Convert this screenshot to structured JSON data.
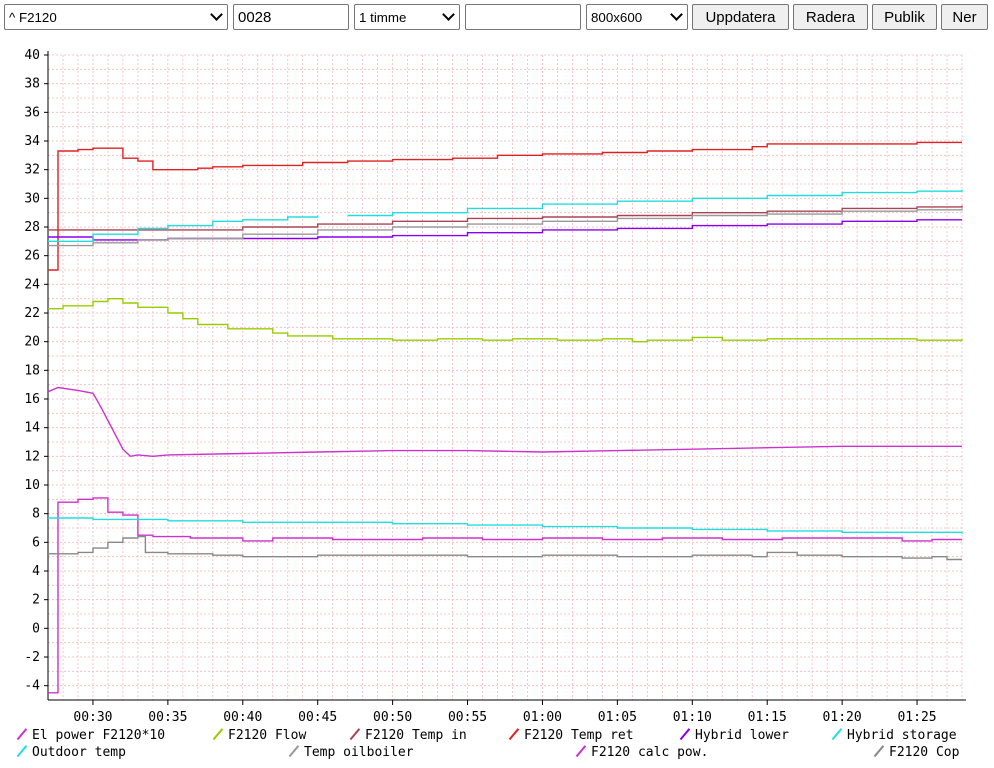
{
  "toolbar": {
    "device_select": "^ F2120",
    "id_input": "0028",
    "period_select": "1 timme",
    "free_input": "",
    "size_select": "800x600",
    "update_label": "Uppdatera",
    "delete_label": "Radera",
    "public_label": "Publik",
    "down_label": "Ner"
  },
  "chart_data": {
    "type": "line",
    "ylim": [
      -5,
      40
    ],
    "xlim": [
      "00:27",
      "01:28"
    ],
    "grid": true,
    "legend_position": "bottom",
    "y_ticks": [
      40,
      38,
      36,
      34,
      32,
      30,
      28,
      26,
      24,
      22,
      20,
      18,
      16,
      14,
      12,
      10,
      8,
      6,
      4,
      2,
      0,
      -2,
      -4
    ],
    "x_ticks": [
      "00:30",
      "00:35",
      "00:40",
      "00:45",
      "00:50",
      "00:55",
      "01:00",
      "01:05",
      "01:10",
      "01:15",
      "01:20",
      "01:25"
    ],
    "series": [
      {
        "name": "El power F2120*10",
        "color": "#cc33cc",
        "step": true,
        "points": [
          [
            "00:27",
            -4.5
          ],
          [
            "00:27:30",
            -4.5
          ],
          [
            "00:27:40",
            8.8
          ],
          [
            "00:29",
            9.0
          ],
          [
            "00:30",
            9.1
          ],
          [
            "00:31",
            8.1
          ],
          [
            "00:32",
            7.9
          ],
          [
            "00:33",
            6.5
          ],
          [
            "00:34",
            6.4
          ],
          [
            "00:36",
            6.4
          ],
          [
            "00:36:30",
            6.3
          ],
          [
            "00:40",
            6.1
          ],
          [
            "00:42",
            6.3
          ],
          [
            "00:46",
            6.2
          ],
          [
            "00:50",
            6.2
          ],
          [
            "00:52",
            6.3
          ],
          [
            "00:56",
            6.2
          ],
          [
            "01:00",
            6.3
          ],
          [
            "01:04",
            6.2
          ],
          [
            "01:08",
            6.3
          ],
          [
            "01:12",
            6.2
          ],
          [
            "01:16",
            6.3
          ],
          [
            "01:20",
            6.3
          ],
          [
            "01:24",
            6.1
          ],
          [
            "01:26",
            6.2
          ],
          [
            "01:28",
            6.2
          ]
        ]
      },
      {
        "name": "F2120 Flow",
        "color": "#99cc00",
        "step": true,
        "points": [
          [
            "00:27",
            22.3
          ],
          [
            "00:28",
            22.5
          ],
          [
            "00:30",
            22.8
          ],
          [
            "00:31",
            23.0
          ],
          [
            "00:32",
            22.7
          ],
          [
            "00:33",
            22.4
          ],
          [
            "00:35",
            22.0
          ],
          [
            "00:36",
            21.6
          ],
          [
            "00:37",
            21.2
          ],
          [
            "00:39",
            20.9
          ],
          [
            "00:42",
            20.6
          ],
          [
            "00:43",
            20.4
          ],
          [
            "00:46",
            20.2
          ],
          [
            "00:50",
            20.1
          ],
          [
            "00:53",
            20.2
          ],
          [
            "00:56",
            20.1
          ],
          [
            "00:58",
            20.2
          ],
          [
            "01:01",
            20.1
          ],
          [
            "01:04",
            20.2
          ],
          [
            "01:06",
            20.0
          ],
          [
            "01:07",
            20.1
          ],
          [
            "01:10",
            20.3
          ],
          [
            "01:12",
            20.1
          ],
          [
            "01:15",
            20.2
          ],
          [
            "01:20",
            20.2
          ],
          [
            "01:25",
            20.1
          ],
          [
            "01:28",
            20.2
          ]
        ]
      },
      {
        "name": "F2120 Temp in",
        "color": "#aa4455",
        "step": true,
        "points": [
          [
            "00:27",
            27.8
          ],
          [
            "00:32",
            27.8
          ],
          [
            "00:34",
            27.8
          ],
          [
            "00:40",
            28.0
          ],
          [
            "00:45",
            28.2
          ],
          [
            "00:50",
            28.4
          ],
          [
            "00:55",
            28.6
          ],
          [
            "01:00",
            28.7
          ],
          [
            "01:05",
            28.8
          ],
          [
            "01:10",
            29.0
          ],
          [
            "01:15",
            29.1
          ],
          [
            "01:20",
            29.3
          ],
          [
            "01:25",
            29.4
          ],
          [
            "01:28",
            29.5
          ]
        ]
      },
      {
        "name": "F2120 Temp ret",
        "color": "#dd2222",
        "step": true,
        "points": [
          [
            "00:27",
            25.0
          ],
          [
            "00:27:30",
            25.0
          ],
          [
            "00:27:40",
            33.3
          ],
          [
            "00:29",
            33.4
          ],
          [
            "00:30",
            33.5
          ],
          [
            "00:32",
            32.8
          ],
          [
            "00:33",
            32.6
          ],
          [
            "00:34",
            32.0
          ],
          [
            "00:37",
            32.1
          ],
          [
            "00:38",
            32.2
          ],
          [
            "00:40",
            32.3
          ],
          [
            "00:44",
            32.5
          ],
          [
            "00:47",
            32.6
          ],
          [
            "00:50",
            32.7
          ],
          [
            "00:54",
            32.8
          ],
          [
            "00:57",
            33.0
          ],
          [
            "01:00",
            33.1
          ],
          [
            "01:04",
            33.2
          ],
          [
            "01:07",
            33.3
          ],
          [
            "01:10",
            33.4
          ],
          [
            "01:14",
            33.6
          ],
          [
            "01:15",
            33.8
          ],
          [
            "01:20",
            33.8
          ],
          [
            "01:25",
            33.9
          ],
          [
            "01:28",
            33.9
          ]
        ]
      },
      {
        "name": "Hybrid lower",
        "color": "#8800ee",
        "step": true,
        "points": [
          [
            "00:27",
            27.3
          ],
          [
            "00:30",
            27.1
          ],
          [
            "00:35",
            27.2
          ],
          [
            "00:40",
            27.2
          ],
          [
            "00:45",
            27.3
          ],
          [
            "00:50",
            27.4
          ],
          [
            "00:55",
            27.6
          ],
          [
            "01:00",
            27.8
          ],
          [
            "01:05",
            27.9
          ],
          [
            "01:10",
            28.1
          ],
          [
            "01:15",
            28.2
          ],
          [
            "01:20",
            28.4
          ],
          [
            "01:25",
            28.5
          ],
          [
            "01:28",
            28.5
          ]
        ]
      },
      {
        "name": "Hybrid storage",
        "color": "#22dddd",
        "step": true,
        "points": [
          [
            "00:27",
            27.0
          ],
          [
            "00:30",
            27.5
          ],
          [
            "00:33",
            27.9
          ],
          [
            "00:35",
            28.1
          ],
          [
            "00:38",
            28.4
          ],
          [
            "00:40",
            28.5
          ],
          [
            "00:43",
            28.7
          ],
          [
            "00:45",
            28.8
          ],
          [
            "00:46",
            null
          ],
          [
            "00:47",
            28.8
          ],
          [
            "00:50",
            29.0
          ],
          [
            "00:55",
            29.3
          ],
          [
            "01:00",
            29.6
          ],
          [
            "01:05",
            29.8
          ],
          [
            "01:10",
            30.0
          ],
          [
            "01:15",
            30.2
          ],
          [
            "01:20",
            30.4
          ],
          [
            "01:25",
            30.5
          ],
          [
            "01:28",
            30.6
          ]
        ]
      },
      {
        "name": "Outdoor temp",
        "color": "#22dddd",
        "step": true,
        "points": [
          [
            "00:27",
            7.7
          ],
          [
            "00:30",
            7.6
          ],
          [
            "00:35",
            7.5
          ],
          [
            "00:40",
            7.4
          ],
          [
            "00:45",
            7.4
          ],
          [
            "00:50",
            7.3
          ],
          [
            "00:55",
            7.2
          ],
          [
            "01:00",
            7.1
          ],
          [
            "01:05",
            7.0
          ],
          [
            "01:10",
            6.9
          ],
          [
            "01:15",
            6.8
          ],
          [
            "01:20",
            6.7
          ],
          [
            "01:25",
            6.7
          ],
          [
            "01:28",
            6.6
          ]
        ]
      },
      {
        "name": "Temp oilboiler",
        "color": "#999999",
        "step": true,
        "points": [
          [
            "00:27",
            26.7
          ],
          [
            "00:30",
            26.9
          ],
          [
            "00:33",
            27.1
          ],
          [
            "00:35",
            27.2
          ],
          [
            "00:40",
            27.5
          ],
          [
            "00:45",
            27.8
          ],
          [
            "00:50",
            28.0
          ],
          [
            "00:55",
            28.2
          ],
          [
            "01:00",
            28.4
          ],
          [
            "01:05",
            28.6
          ],
          [
            "01:10",
            28.8
          ],
          [
            "01:15",
            28.9
          ],
          [
            "01:20",
            29.1
          ],
          [
            "01:25",
            29.2
          ],
          [
            "01:28",
            29.3
          ]
        ]
      },
      {
        "name": "F2120 calc pow.",
        "color": "#cc33cc",
        "step": false,
        "points": [
          [
            "00:27",
            16.5
          ],
          [
            "00:27:40",
            16.8
          ],
          [
            "00:29",
            16.6
          ],
          [
            "00:30",
            16.4
          ],
          [
            "00:30:30",
            15.5
          ],
          [
            "00:31",
            14.5
          ],
          [
            "00:31:30",
            13.5
          ],
          [
            "00:32",
            12.5
          ],
          [
            "00:32:30",
            12.0
          ],
          [
            "00:33",
            12.1
          ],
          [
            "00:34",
            12.0
          ],
          [
            "00:35",
            12.1
          ],
          [
            "00:40",
            12.2
          ],
          [
            "00:45",
            12.3
          ],
          [
            "00:50",
            12.4
          ],
          [
            "00:55",
            12.4
          ],
          [
            "01:00",
            12.3
          ],
          [
            "01:05",
            12.4
          ],
          [
            "01:10",
            12.5
          ],
          [
            "01:15",
            12.6
          ],
          [
            "01:20",
            12.7
          ],
          [
            "01:25",
            12.7
          ],
          [
            "01:28",
            12.7
          ]
        ]
      },
      {
        "name": "F2120 Cop",
        "color": "#888888",
        "step": true,
        "points": [
          [
            "00:27",
            5.2
          ],
          [
            "00:29",
            5.3
          ],
          [
            "00:30",
            5.6
          ],
          [
            "00:31",
            6.0
          ],
          [
            "00:32",
            6.3
          ],
          [
            "00:33",
            6.4
          ],
          [
            "00:33:30",
            5.3
          ],
          [
            "00:35",
            5.2
          ],
          [
            "00:38",
            5.1
          ],
          [
            "00:40",
            5.0
          ],
          [
            "00:45",
            5.1
          ],
          [
            "00:50",
            5.1
          ],
          [
            "00:55",
            5.0
          ],
          [
            "01:00",
            5.1
          ],
          [
            "01:05",
            5.0
          ],
          [
            "01:10",
            5.1
          ],
          [
            "01:14",
            5.0
          ],
          [
            "01:15",
            5.3
          ],
          [
            "01:17",
            5.1
          ],
          [
            "01:20",
            5.0
          ],
          [
            "01:24",
            4.9
          ],
          [
            "01:26",
            5.0
          ],
          [
            "01:27",
            4.8
          ],
          [
            "01:28",
            4.8
          ]
        ]
      }
    ]
  }
}
